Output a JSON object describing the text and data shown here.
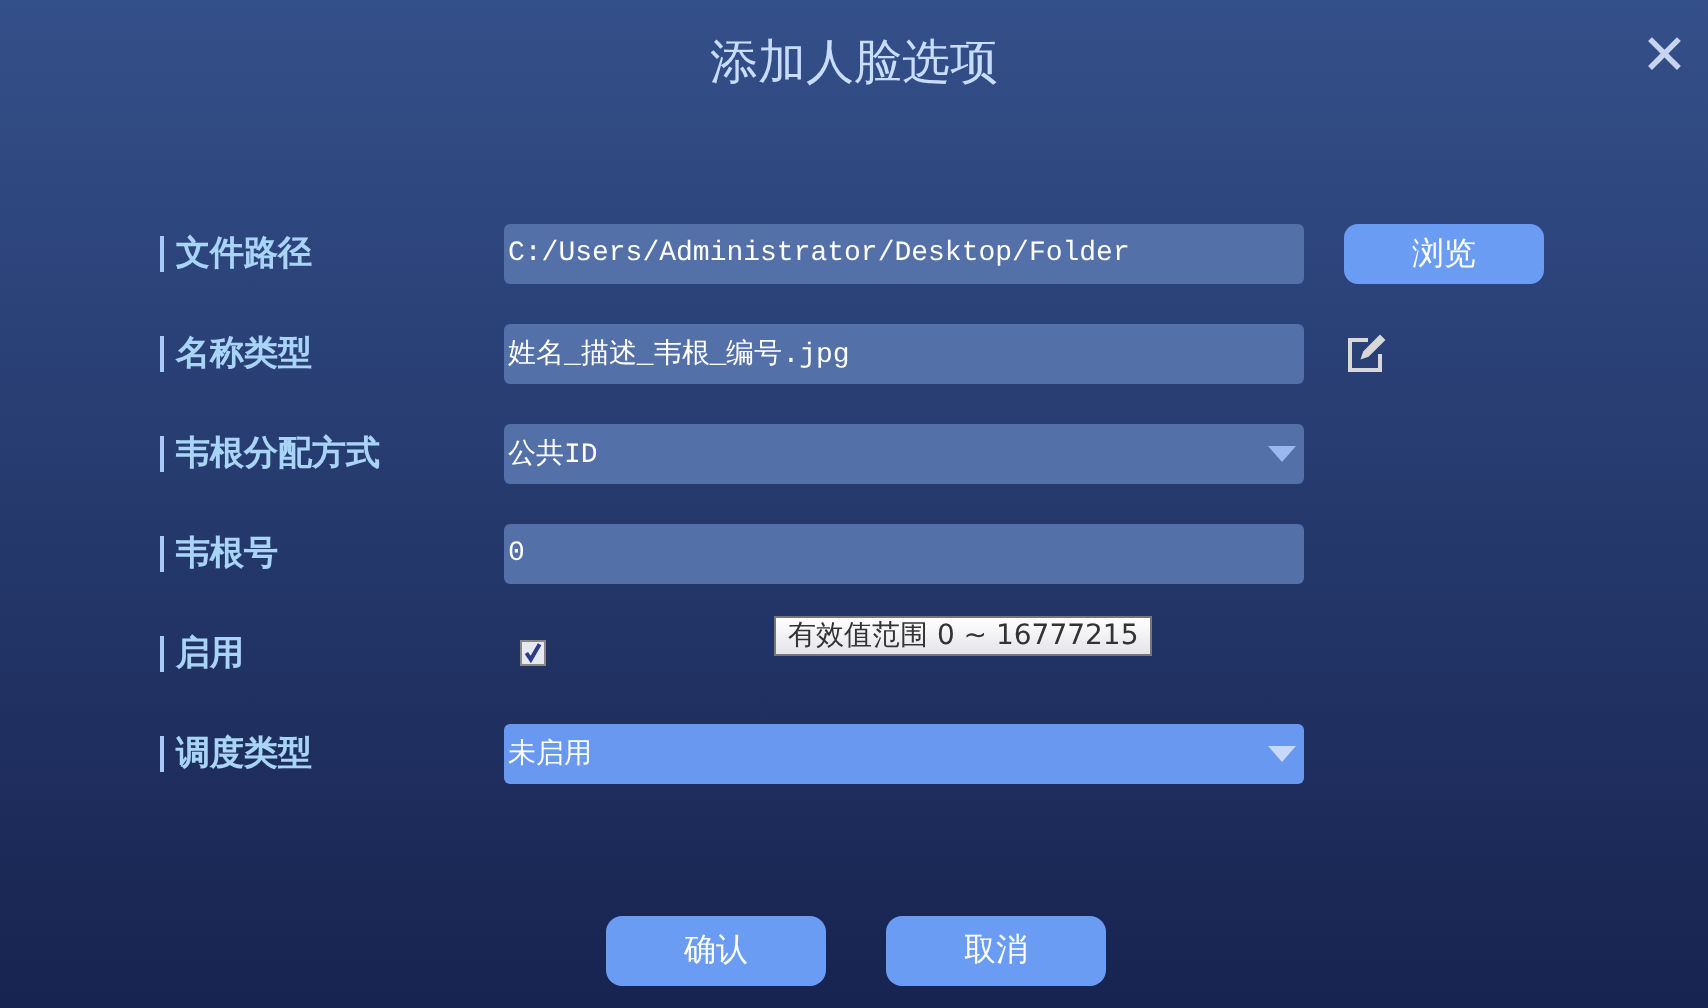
{
  "window": {
    "title": "添加人脸选项",
    "close": "✕"
  },
  "rows": [
    {
      "kind": "text",
      "label": "文件路径",
      "value": "C:/Users/Administrator/Desktop/Folder",
      "button": "浏览"
    },
    {
      "kind": "text-edit",
      "label": "名称类型",
      "value": "姓名_描述_韦根_编号.jpg"
    },
    {
      "kind": "select",
      "label": "韦根分配方式",
      "value": "公共ID",
      "highlighted": false
    },
    {
      "kind": "text",
      "label": "韦根号",
      "value": "0"
    },
    {
      "kind": "checkbox",
      "label": "启用",
      "checked": true,
      "tooltip": "有效值范围 0 ~ 16777215"
    },
    {
      "kind": "select",
      "label": "调度类型",
      "value": "未启用",
      "highlighted": true
    }
  ],
  "buttons": [
    "确认",
    "取消"
  ]
}
